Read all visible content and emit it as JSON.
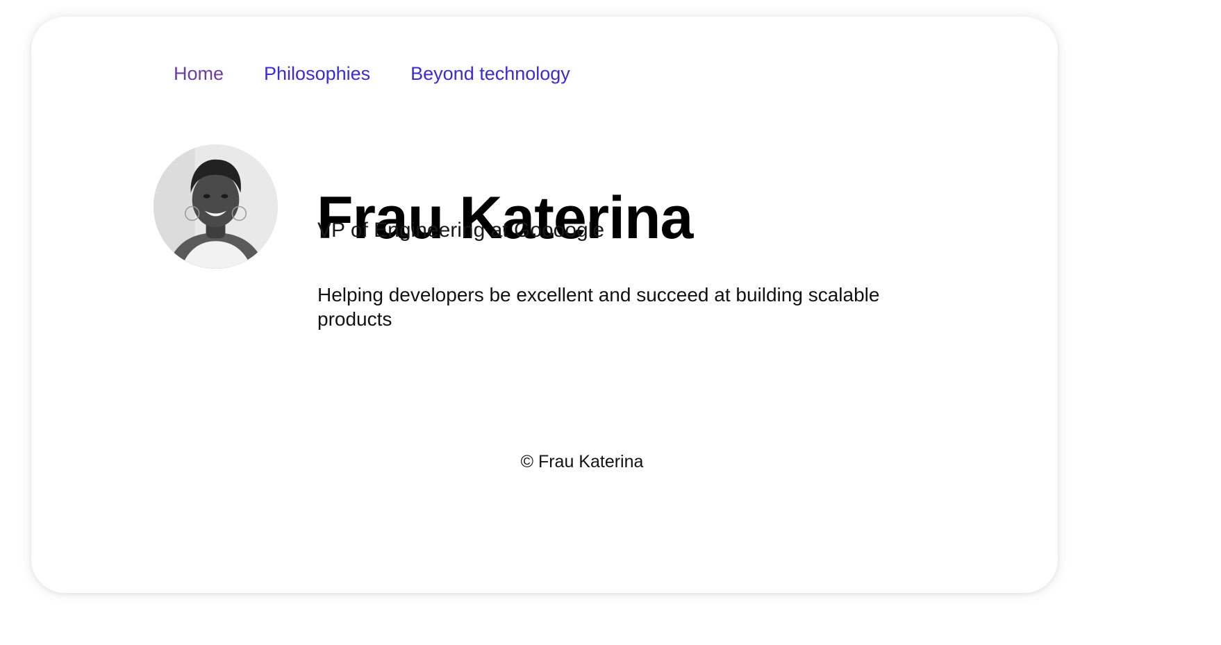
{
  "nav": {
    "items": [
      {
        "label": "Home",
        "state": "visited"
      },
      {
        "label": "Philosophies",
        "state": "unvisited"
      },
      {
        "label": "Beyond technology",
        "state": "unvisited"
      }
    ]
  },
  "profile": {
    "name": "Frau Katerina",
    "role": "VP of Engineering at Goooogle",
    "bio": "Helping developers be excellent and succeed at building scalable products",
    "avatar_icon": "portrait-photo"
  },
  "footer": {
    "copyright": "© Frau Katerina"
  },
  "colors": {
    "link_visited": "#6b3fa0",
    "link": "#3b2bd6",
    "text": "#111111"
  }
}
